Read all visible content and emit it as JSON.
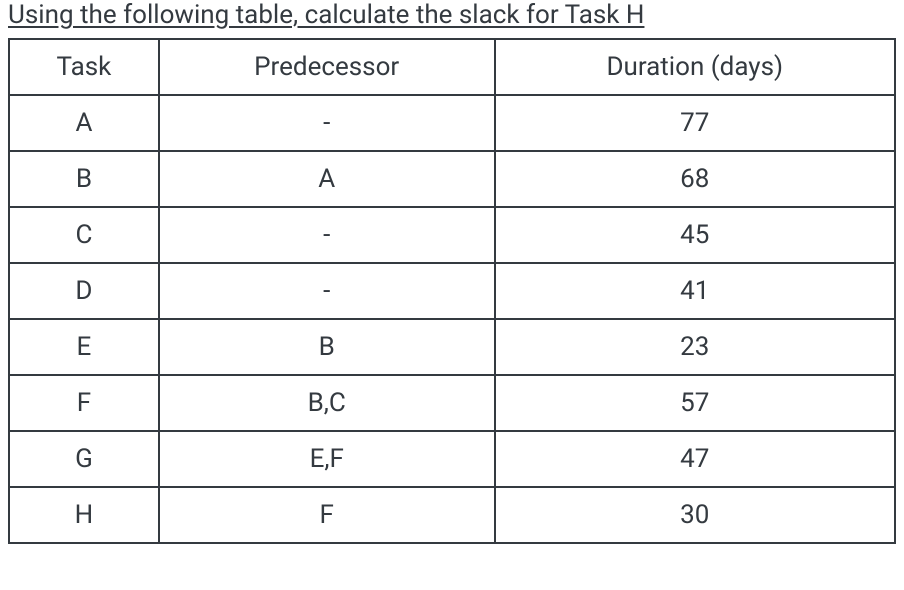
{
  "title": "Using the following table, calculate the slack for Task H",
  "headers": {
    "col0": "Task",
    "col1": "Predecessor",
    "col2": "Duration (days)"
  },
  "rows": [
    {
      "task": "A",
      "predecessor": "-",
      "duration": "77"
    },
    {
      "task": "B",
      "predecessor": "A",
      "duration": "68"
    },
    {
      "task": "C",
      "predecessor": "-",
      "duration": "45"
    },
    {
      "task": "D",
      "predecessor": "-",
      "duration": "41"
    },
    {
      "task": "E",
      "predecessor": "B",
      "duration": "23"
    },
    {
      "task": "F",
      "predecessor": "B,C",
      "duration": "57"
    },
    {
      "task": "G",
      "predecessor": "E,F",
      "duration": "47"
    },
    {
      "task": "H",
      "predecessor": "F",
      "duration": "30"
    }
  ],
  "chart_data": {
    "type": "table",
    "title": "Using the following table, calculate the slack for Task H",
    "columns": [
      "Task",
      "Predecessor",
      "Duration (days)"
    ],
    "data": [
      [
        "A",
        "-",
        77
      ],
      [
        "B",
        "A",
        68
      ],
      [
        "C",
        "-",
        45
      ],
      [
        "D",
        "-",
        41
      ],
      [
        "E",
        "B",
        23
      ],
      [
        "F",
        "B,C",
        57
      ],
      [
        "G",
        "E,F",
        47
      ],
      [
        "H",
        "F",
        30
      ]
    ]
  }
}
